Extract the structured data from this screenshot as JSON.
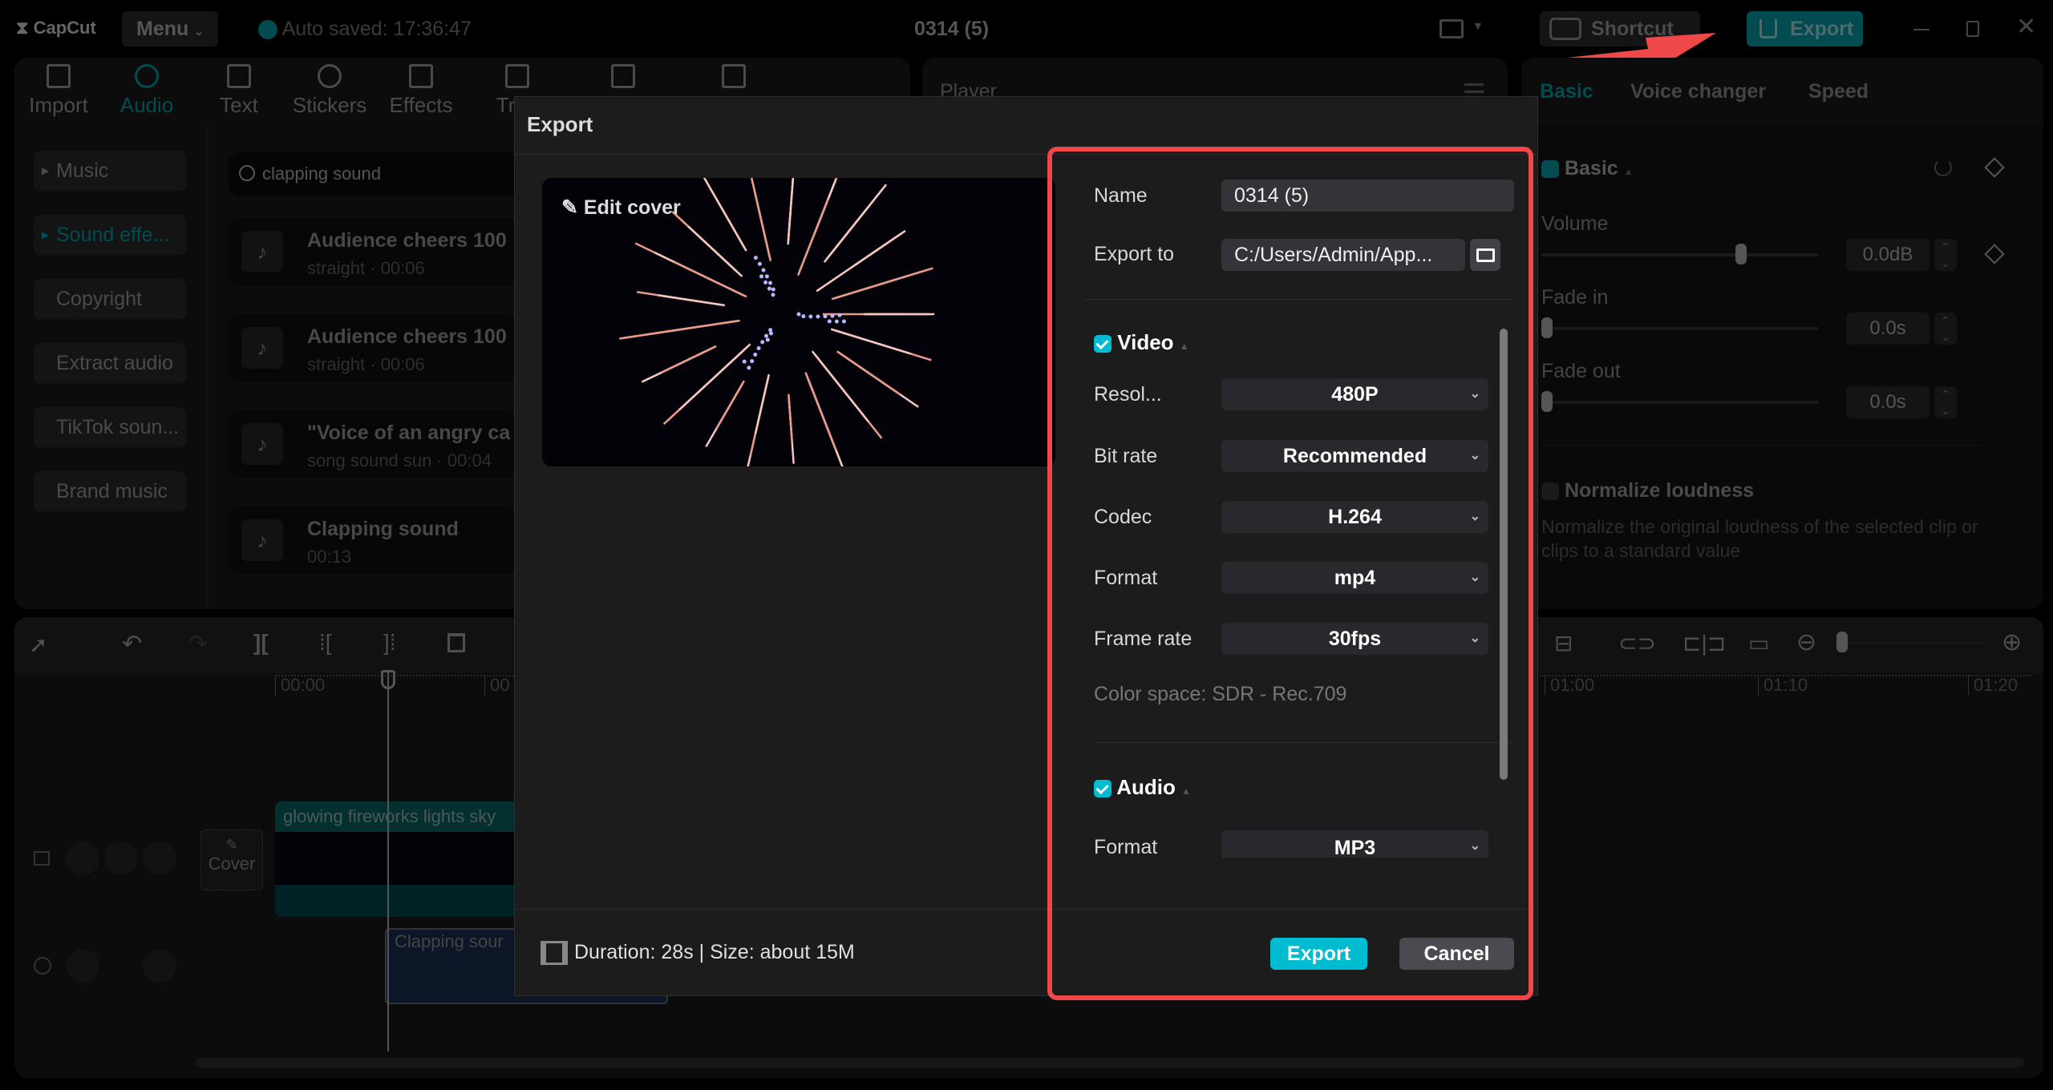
{
  "titlebar": {
    "logo": "CapCut",
    "menu": "Menu",
    "autosave": "Auto saved: 17:36:47",
    "project_title": "0314 (5)",
    "shortcut": "Shortcut",
    "export": "Export"
  },
  "toolbar_tabs": [
    {
      "label": "Import",
      "icon": "import-icon"
    },
    {
      "label": "Audio",
      "icon": "audio-icon",
      "active": true
    },
    {
      "label": "Text",
      "icon": "text-icon"
    },
    {
      "label": "Stickers",
      "icon": "sticker-icon"
    },
    {
      "label": "Effects",
      "icon": "effects-icon"
    },
    {
      "label": "Tran",
      "icon": "transitions-icon"
    },
    {
      "label": "",
      "icon": "filters-icon"
    },
    {
      "label": "",
      "icon": "adjust-icon"
    }
  ],
  "audio_categories": [
    {
      "label": "Music",
      "arrow": true
    },
    {
      "label": "Sound effe...",
      "arrow": true,
      "active": true
    },
    {
      "label": "Copyright"
    },
    {
      "label": "Extract audio"
    },
    {
      "label": "TikTok soun..."
    },
    {
      "label": "Brand music"
    }
  ],
  "search": {
    "value": "clapping sound"
  },
  "sound_list": [
    {
      "title": "Audience cheers 100",
      "sub": "straight · 00:06"
    },
    {
      "title": "Audience cheers 100",
      "sub": "straight · 00:06"
    },
    {
      "title": "\"Voice of an angry ca",
      "sub": "song sound sun · 00:04"
    },
    {
      "title": "Clapping sound",
      "sub": "00:13"
    }
  ],
  "player": {
    "label": "Player"
  },
  "right_panel": {
    "tabs": [
      "Basic",
      "Voice changer",
      "Speed"
    ],
    "section": "Basic",
    "volume_label": "Volume",
    "volume_value": "0.0dB",
    "volume_level": 0.73,
    "fade_in_label": "Fade in",
    "fade_in_value": "0.0s",
    "fade_out_label": "Fade out",
    "fade_out_value": "0.0s",
    "normalize_label": "Normalize loudness",
    "normalize_checked": false,
    "normalize_desc": "Normalize the original loudness of the selected clip or clips to a standard value"
  },
  "timeline": {
    "ruler": [
      "00:00",
      "00",
      "01:00",
      "01:10",
      "01:20"
    ],
    "video_clip": "glowing fireworks lights sky",
    "audio_clip": "Clapping sour",
    "cover": "Cover"
  },
  "export_dialog": {
    "title": "Export",
    "edit_cover": "Edit cover",
    "name_label": "Name",
    "name_value": "0314 (5)",
    "export_to_label": "Export to",
    "export_to_value": "C:/Users/Admin/App...",
    "video_section": "Video",
    "video_checked": true,
    "fields": [
      {
        "label": "Resol...",
        "value": "480P"
      },
      {
        "label": "Bit rate",
        "value": "Recommended"
      },
      {
        "label": "Codec",
        "value": "H.264"
      },
      {
        "label": "Format",
        "value": "mp4"
      },
      {
        "label": "Frame rate",
        "value": "30fps"
      }
    ],
    "color_space": "Color space: SDR - Rec.709",
    "audio_section": "Audio",
    "audio_checked": true,
    "audio_format_label": "Format",
    "audio_format_value": "MP3",
    "summary": "Duration: 28s | Size: about 15M",
    "export_button": "Export",
    "cancel_button": "Cancel"
  },
  "colors": {
    "accent": "#00bcd0",
    "annotation": "#f04848",
    "dialog_bg": "#1c1c1c",
    "export_top": "#024b50"
  }
}
